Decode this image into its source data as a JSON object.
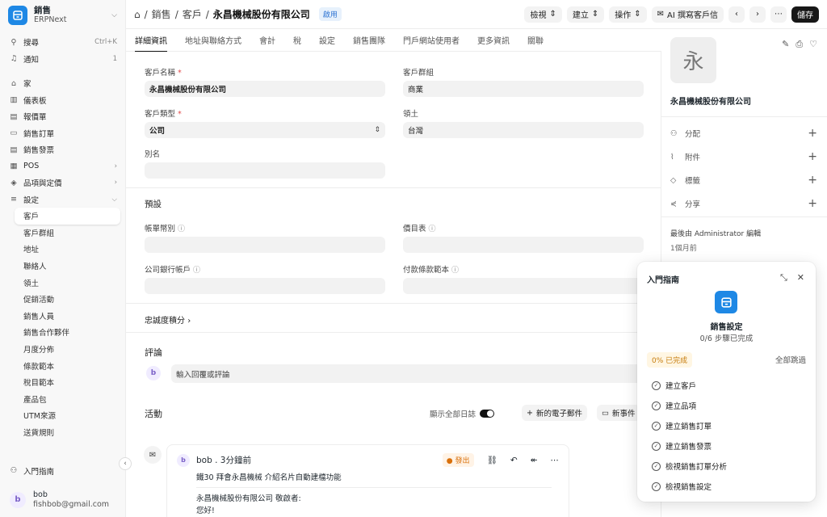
{
  "brand": {
    "title": "銷售",
    "subtitle": "ERPNext"
  },
  "sidebar": {
    "search": {
      "label": "搜尋",
      "shortcut": "Ctrl+K"
    },
    "notifications": {
      "label": "通知",
      "count": "1"
    },
    "items": [
      {
        "label": "家",
        "icon": "home-icon"
      },
      {
        "label": "儀表板",
        "icon": "dashboard-icon"
      },
      {
        "label": "報價單",
        "icon": "quotation-icon"
      },
      {
        "label": "銷售訂單",
        "icon": "sales-order-icon"
      },
      {
        "label": "銷售發票",
        "icon": "invoice-icon"
      },
      {
        "label": "POS",
        "icon": "pos-icon"
      },
      {
        "label": "品項與定價",
        "icon": "box-icon"
      },
      {
        "label": "設定",
        "icon": "database-icon"
      }
    ],
    "subitems": [
      "客戶",
      "客戶群組",
      "地址",
      "聯絡人",
      "領土",
      "促銷活動",
      "銷售人員",
      "銷售合作夥伴",
      "月度分佈",
      "條款範本",
      "稅目範本",
      "產品包",
      "UTM來源",
      "送貨規則"
    ],
    "guide_label": "入門指南",
    "user": {
      "initial": "b",
      "name": "bob",
      "email": "fishbob@gmail.com"
    }
  },
  "topbar": {
    "crumbs": [
      "銷售",
      "客戶"
    ],
    "current": "永昌機械股份有限公司",
    "status": "啟用",
    "view": "檢視",
    "create": "建立",
    "actions": "操作",
    "ai": "AI 撰寫客戶信",
    "save": "儲存"
  },
  "tabs": [
    "詳細資訊",
    "地址與聯絡方式",
    "會計",
    "稅",
    "設定",
    "銷售團隊",
    "門戶網站使用者",
    "更多資訊",
    "關聯"
  ],
  "form": {
    "customer_name_label": "客戶名稱",
    "customer_name": "永昌機械股份有限公司",
    "customer_group_label": "客戶群組",
    "customer_group": "商業",
    "customer_type_label": "客戶類型",
    "customer_type": "公司",
    "territory_label": "領土",
    "territory": "台灣",
    "alias_label": "別名",
    "defaults_title": "預設",
    "currency_label": "帳單幣別",
    "price_list_label": "價目表",
    "bank_label": "公司銀行帳戶",
    "payment_terms_label": "付款條款範本",
    "loyalty_label": "忠誠度積分"
  },
  "comments": {
    "title": "評論",
    "placeholder": "輸入回覆或評論",
    "initial": "b"
  },
  "activity": {
    "title": "活動",
    "show_all": "顯示全部日誌",
    "new_email": "新的電子郵件",
    "new_event": "新事件",
    "card": {
      "initial": "b",
      "author": "bob . 3分鐘前",
      "status": "發出",
      "subject": "鐵30 拜會永昌機械 介紹名片自動建檔功能",
      "line1": "永昌機械股份有限公司 敬啟者:",
      "line2": "您好!"
    }
  },
  "right_panel": {
    "avatar_letter": "永",
    "name": "永昌機械股份有限公司",
    "actions": [
      {
        "label": "分配",
        "icon": "users-icon"
      },
      {
        "label": "附件",
        "icon": "paperclip-icon"
      },
      {
        "label": "標籤",
        "icon": "tag-icon"
      },
      {
        "label": "分享",
        "icon": "share-icon"
      }
    ],
    "edited_by": "最後由 Administrator 編輯",
    "edited_time": "1個月前"
  },
  "guide": {
    "title": "入門指南",
    "name": "銷售設定",
    "progress": "0/6 步驟已完成",
    "percent": "0% 已完成",
    "skip": "全部跳過",
    "steps": [
      "建立客戶",
      "建立品項",
      "建立銷售訂單",
      "建立銷售發票",
      "檢視銷售訂單分析",
      "檢視銷售設定"
    ]
  }
}
